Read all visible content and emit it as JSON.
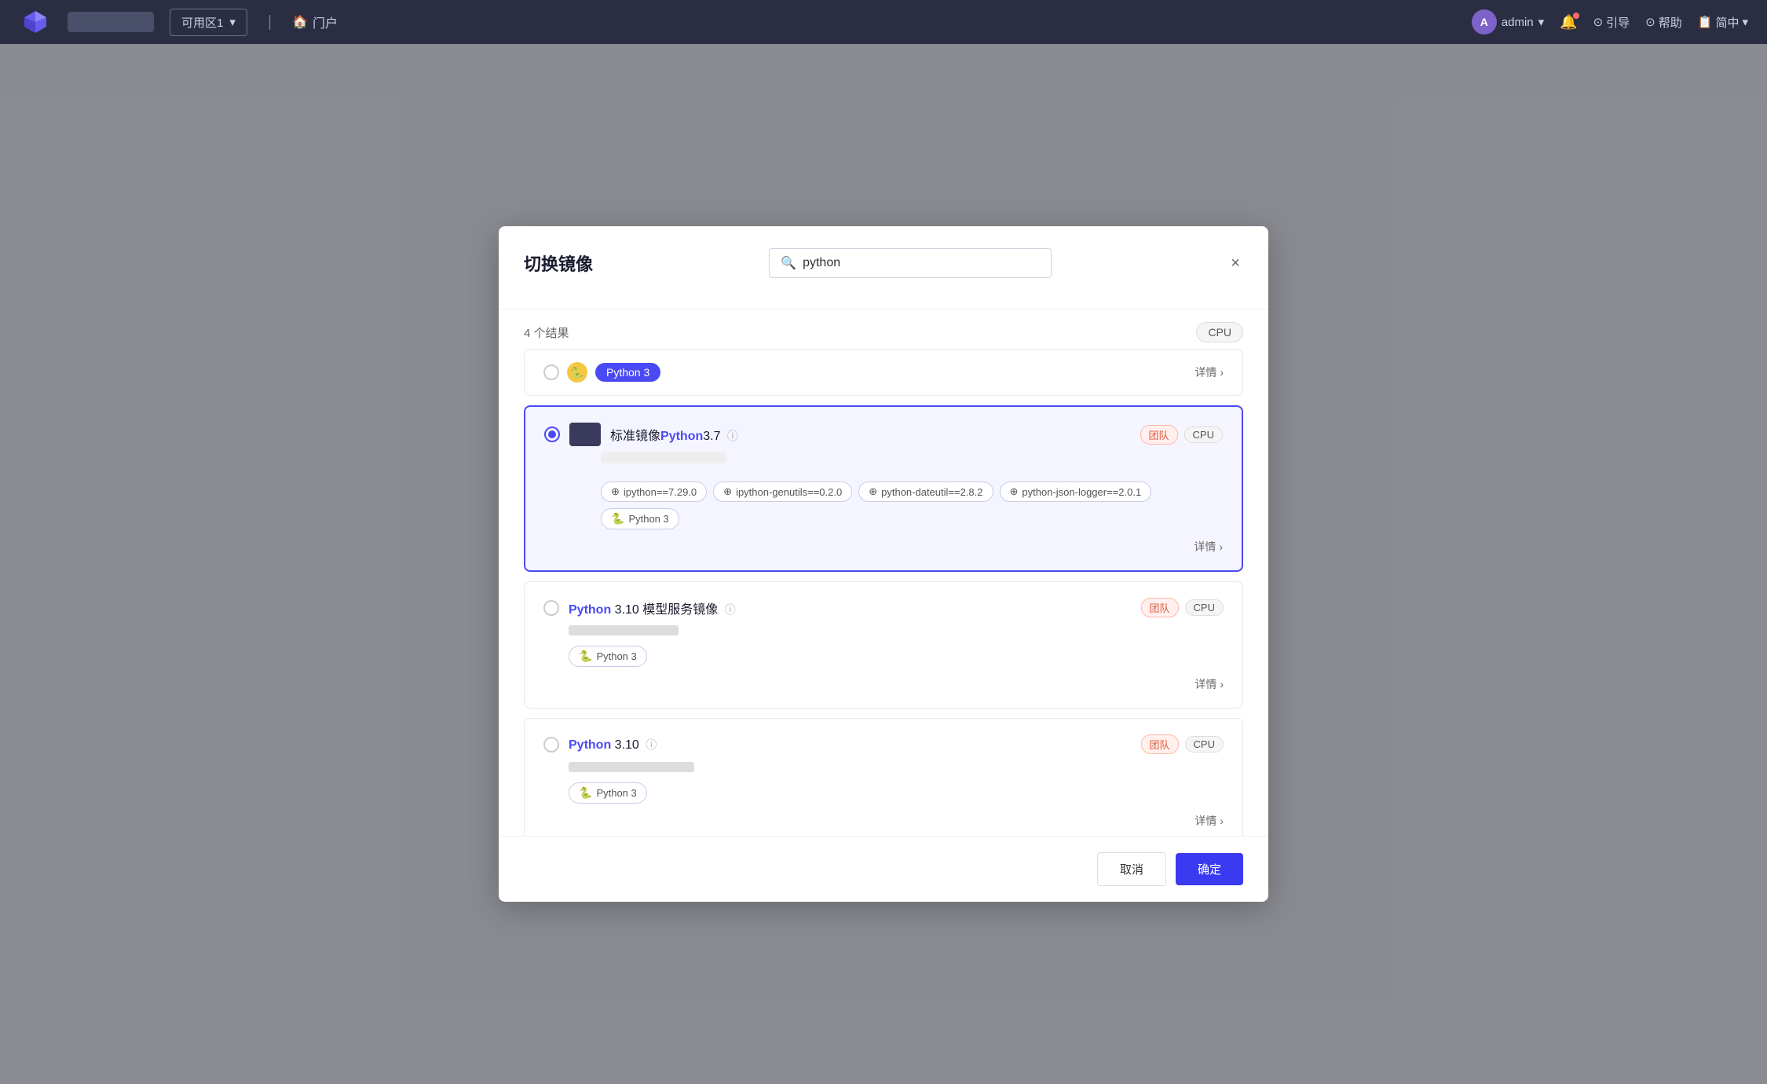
{
  "nav": {
    "logo_label": "M",
    "region_label": "可用区1",
    "home_label": "门户",
    "home_icon": "🏠",
    "admin_label": "admin",
    "bell_icon": "🔔",
    "guide_label": "引导",
    "help_label": "帮助",
    "lang_label": "简中"
  },
  "modal": {
    "title": "切换镜像",
    "search_placeholder": "python",
    "search_value": "python",
    "close_label": "×",
    "tabs": [
      {
        "id": "tab1",
        "label": ""
      },
      {
        "id": "tab2",
        "label": ""
      }
    ],
    "results_count": "4 个结果",
    "cpu_filter_label": "CPU",
    "partial_card": {
      "name_label": "Python 3",
      "detail_label": "详情",
      "detail_arrow": "›"
    },
    "cards": [
      {
        "id": "card1",
        "selected": true,
        "name_prefix": "标准镜像",
        "name_highlight": "Python",
        "name_suffix": "3.7",
        "badge_team": "团队",
        "badge_cpu": "CPU",
        "tags": [
          {
            "icon": "⊕",
            "label": "ipython==7.29.0"
          },
          {
            "icon": "⊕",
            "label": "ipython-genutils==0.2.0"
          },
          {
            "icon": "⊕",
            "label": "python-dateutil==2.8.2"
          },
          {
            "icon": "⊕",
            "label": "python-json-logger==2.0.1"
          },
          {
            "type": "python",
            "label": "Python 3"
          }
        ],
        "detail_label": "详情",
        "detail_arrow": "›"
      },
      {
        "id": "card2",
        "selected": false,
        "name_prefix": "",
        "name_highlight": "Python",
        "name_suffix": " 3.10 模型服务镜像",
        "badge_team": "团队",
        "badge_cpu": "CPU",
        "tags": [
          {
            "type": "python",
            "label": "Python 3"
          }
        ],
        "detail_label": "详情",
        "detail_arrow": "›"
      },
      {
        "id": "card3",
        "selected": false,
        "name_prefix": "",
        "name_highlight": "Python",
        "name_suffix": " 3.10",
        "badge_team": "团队",
        "badge_cpu": "CPU",
        "tags": [
          {
            "type": "python",
            "label": "Python 3"
          }
        ],
        "detail_label": "详情",
        "detail_arrow": "›"
      }
    ],
    "cancel_label": "取消",
    "confirm_label": "确定"
  }
}
